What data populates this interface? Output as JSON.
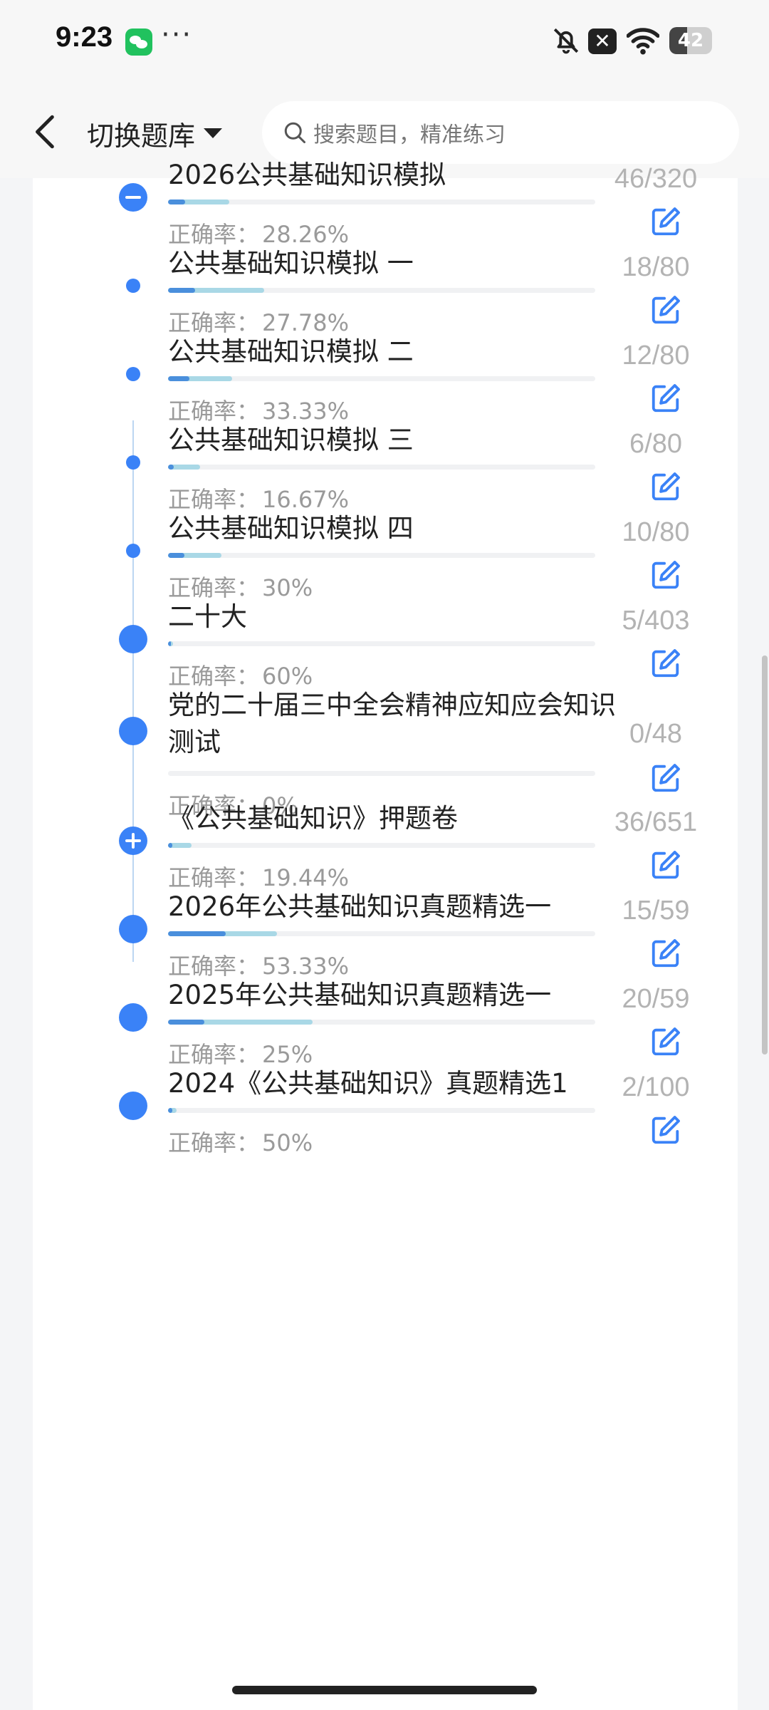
{
  "status_bar": {
    "time": "9:23",
    "more": "···",
    "close_symbol": "✕",
    "battery_level": 42,
    "icons": [
      "wechat-icon",
      "bell-off-icon",
      "close-box-icon",
      "wifi-icon",
      "battery-icon"
    ]
  },
  "header": {
    "switch_label": "切换题库",
    "search_placeholder": "搜索题目，精准练习"
  },
  "rate_label": "正确率：",
  "colors": {
    "accent": "#3a82f7",
    "correct_bar": "#4a8fdc",
    "attempted_bar": "#a9d8e6",
    "muted_text": "#9a9a9a"
  },
  "items": [
    {
      "title": "2026公共基础知识模拟",
      "rate": "28.26%",
      "count": "46/320",
      "node": "collapse",
      "attempted_fraction": 0.14375,
      "correct_fraction": 0.040625
    },
    {
      "title": "公共基础知识模拟 一",
      "rate": "27.78%",
      "count": "18/80",
      "node": "sub",
      "attempted_fraction": 0.225,
      "correct_fraction": 0.0625
    },
    {
      "title": "公共基础知识模拟 二",
      "rate": "33.33%",
      "count": "12/80",
      "node": "sub",
      "attempted_fraction": 0.15,
      "correct_fraction": 0.05
    },
    {
      "title": "公共基础知识模拟 三",
      "rate": "16.67%",
      "count": "6/80",
      "node": "sub",
      "attempted_fraction": 0.075,
      "correct_fraction": 0.0125
    },
    {
      "title": "公共基础知识模拟 四",
      "rate": "30%",
      "count": "10/80",
      "node": "sub",
      "attempted_fraction": 0.125,
      "correct_fraction": 0.0375
    },
    {
      "title": "二十大",
      "rate": "60%",
      "count": "5/403",
      "node": "dot",
      "attempted_fraction": 0.0124,
      "correct_fraction": 0.0074
    },
    {
      "title": "党的二十届三中全会精神应知应会知识测试",
      "rate": "0%",
      "count": "0/48",
      "node": "dot",
      "attempted_fraction": 0,
      "correct_fraction": 0
    },
    {
      "title": "《公共基础知识》押题卷",
      "rate": "19.44%",
      "count": "36/651",
      "node": "expand",
      "attempted_fraction": 0.0553,
      "correct_fraction": 0.0108
    },
    {
      "title": "2026年公共基础知识真题精选一",
      "rate": "53.33%",
      "count": "15/59",
      "node": "dot",
      "attempted_fraction": 0.2542,
      "correct_fraction": 0.1356
    },
    {
      "title": "2025年公共基础知识真题精选一",
      "rate": "25%",
      "count": "20/59",
      "node": "dot",
      "attempted_fraction": 0.339,
      "correct_fraction": 0.0847
    },
    {
      "title": "2024《公共基础知识》真题精选1",
      "rate": "50%",
      "count": "2/100",
      "node": "dot",
      "attempted_fraction": 0.02,
      "correct_fraction": 0.01
    }
  ]
}
